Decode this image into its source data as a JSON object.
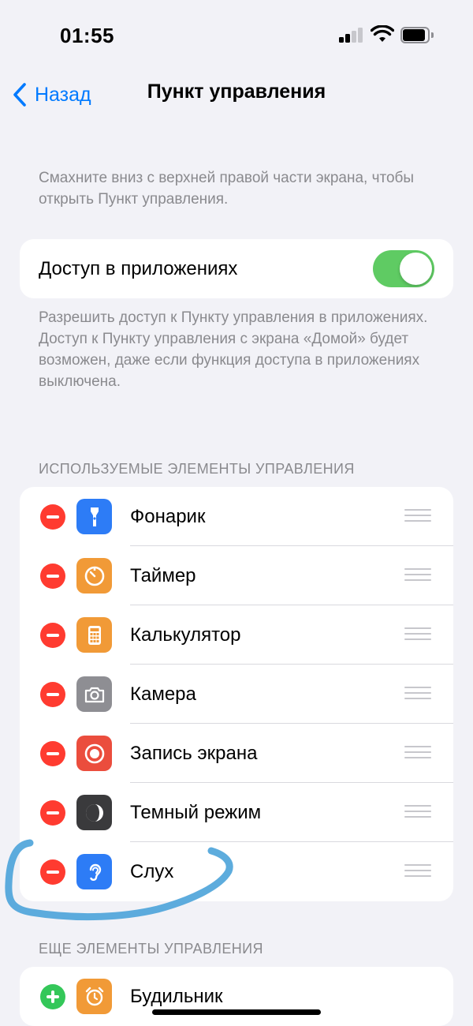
{
  "status_bar": {
    "time": "01:55"
  },
  "nav": {
    "back_label": "Назад",
    "title": "Пункт управления"
  },
  "intro_text": "Смахните вниз с верхней правой части экрана, чтобы открыть Пункт управления.",
  "access": {
    "label": "Доступ в приложениях",
    "enabled": true
  },
  "access_footnote": "Разрешить доступ к Пункту управления в приложениях. Доступ к Пункту управления с экрана «Домой» будет возможен, даже если функция доступа в приложениях выключена.",
  "included_section": {
    "header": "ИСПОЛЬЗУЕМЫЕ ЭЛЕМЕНТЫ УПРАВЛЕНИЯ",
    "items": [
      {
        "label": "Фонарик",
        "icon": "flashlight-icon",
        "color": "#2d7cf6"
      },
      {
        "label": "Таймер",
        "icon": "timer-icon",
        "color": "#f19a37"
      },
      {
        "label": "Калькулятор",
        "icon": "calculator-icon",
        "color": "#f19a37"
      },
      {
        "label": "Камера",
        "icon": "camera-icon",
        "color": "#8e8e93"
      },
      {
        "label": "Запись экрана",
        "icon": "screen-record-icon",
        "color": "#eb4d3d"
      },
      {
        "label": "Темный режим",
        "icon": "dark-mode-icon",
        "color": "#3a3a3c"
      },
      {
        "label": "Слух",
        "icon": "hearing-icon",
        "color": "#2d7cf6"
      }
    ]
  },
  "more_section": {
    "header": "ЕЩЕ ЭЛЕМЕНТЫ УПРАВЛЕНИЯ",
    "items": [
      {
        "label": "Будильник",
        "icon": "alarm-icon",
        "color": "#f19a37"
      }
    ]
  },
  "colors": {
    "accent": "#007aff",
    "toggle_on": "#5fcb63",
    "remove": "#ff3b30",
    "add": "#34c759",
    "annotation": "#4ba3d9"
  }
}
